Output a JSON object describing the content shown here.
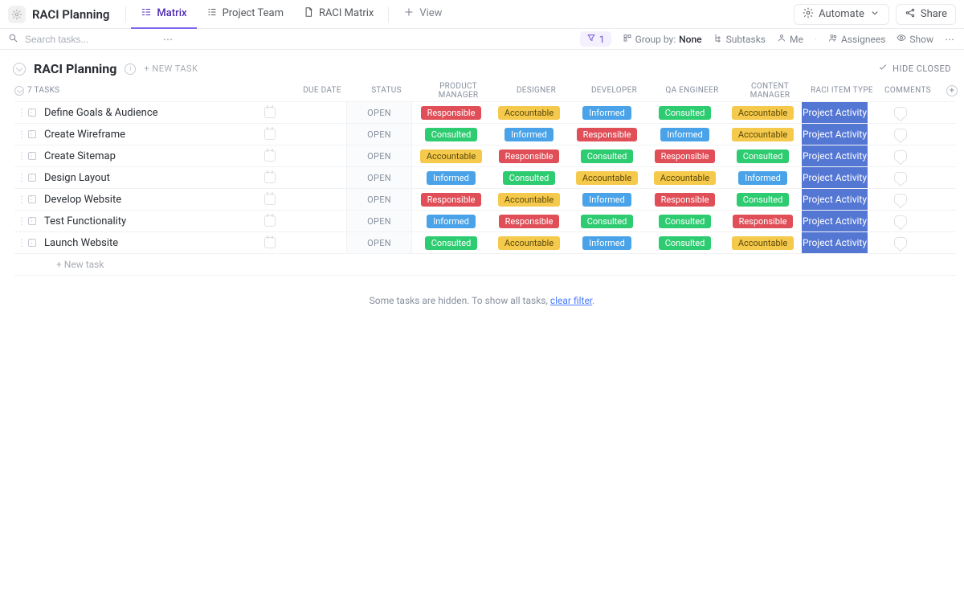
{
  "header": {
    "space_name": "RACI Planning",
    "tabs": [
      {
        "label": "Matrix",
        "active": true
      },
      {
        "label": "Project Team",
        "active": false
      },
      {
        "label": "RACI Matrix",
        "active": false
      }
    ],
    "view_btn": "View",
    "automate_btn": "Automate",
    "share_btn": "Share"
  },
  "toolbar": {
    "search_placeholder": "Search tasks...",
    "filter_count": "1",
    "group_by_label": "Group by:",
    "group_by_value": "None",
    "subtasks": "Subtasks",
    "me": "Me",
    "assignees": "Assignees",
    "show": "Show"
  },
  "section": {
    "name": "RACI Planning",
    "new_task_inline": "+ NEW TASK",
    "hide_closed": "HIDE CLOSED"
  },
  "columns": {
    "task_count": "7 TASKS",
    "due_date": "DUE DATE",
    "status": "STATUS",
    "roles": [
      "PRODUCT MANAGER",
      "DESIGNER",
      "DEVELOPER",
      "QA ENGINEER",
      "CONTENT MANAGER"
    ],
    "type": "RACI ITEM TYPE",
    "comments": "COMMENTS"
  },
  "type_value": "Project Activity",
  "status_value": "OPEN",
  "rows": [
    {
      "name": "Define Goals & Audience",
      "roles": [
        "Responsible",
        "Accountable",
        "Informed",
        "Consulted",
        "Accountable"
      ]
    },
    {
      "name": "Create Wireframe",
      "roles": [
        "Consulted",
        "Informed",
        "Responsible",
        "Informed",
        "Accountable"
      ]
    },
    {
      "name": "Create Sitemap",
      "roles": [
        "Accountable",
        "Responsible",
        "Consulted",
        "Responsible",
        "Consulted"
      ]
    },
    {
      "name": "Design Layout",
      "roles": [
        "Informed",
        "Consulted",
        "Accountable",
        "Accountable",
        "Informed"
      ]
    },
    {
      "name": "Develop Website",
      "roles": [
        "Responsible",
        "Accountable",
        "Informed",
        "Responsible",
        "Consulted"
      ]
    },
    {
      "name": "Test Functionality",
      "roles": [
        "Informed",
        "Responsible",
        "Consulted",
        "Consulted",
        "Responsible"
      ]
    },
    {
      "name": "Launch Website",
      "roles": [
        "Consulted",
        "Accountable",
        "Informed",
        "Consulted",
        "Accountable"
      ]
    }
  ],
  "new_task_row": "+ New task",
  "hidden_msg": {
    "prefix": "Some tasks are hidden. To show all tasks, ",
    "link": "clear filter",
    "suffix": "."
  }
}
